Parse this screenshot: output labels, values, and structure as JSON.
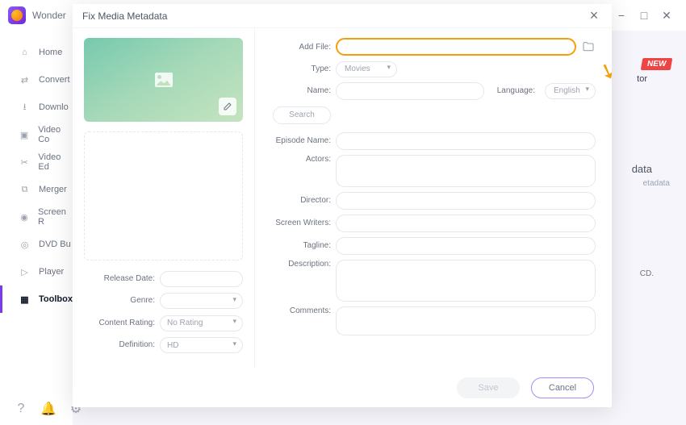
{
  "app": {
    "name": "Wonder"
  },
  "window": {
    "min": "−",
    "max": "□",
    "close": "✕"
  },
  "sidebar": {
    "items": [
      {
        "label": "Home"
      },
      {
        "label": "Convert"
      },
      {
        "label": "Downlo"
      },
      {
        "label": "Video Co"
      },
      {
        "label": "Video Ed"
      },
      {
        "label": "Merger"
      },
      {
        "label": "Screen R"
      },
      {
        "label": "DVD Bu"
      },
      {
        "label": "Player"
      },
      {
        "label": "Toolbox"
      }
    ]
  },
  "bg": {
    "badge": "NEW",
    "hint1": "tor",
    "heading": "data",
    "sub": "etadata",
    "cd": "CD."
  },
  "modal": {
    "title": "Fix Media Metadata",
    "addfile": {
      "label": "Add File:"
    },
    "type": {
      "label": "Type:",
      "value": "Movies"
    },
    "name": {
      "label": "Name:"
    },
    "language": {
      "label": "Language:",
      "value": "English"
    },
    "search": "Search",
    "episode": {
      "label": "Episode Name:"
    },
    "actors": {
      "label": "Actors:"
    },
    "director": {
      "label": "Director:"
    },
    "writers": {
      "label": "Screen Writers:"
    },
    "tagline": {
      "label": "Tagline:"
    },
    "description": {
      "label": "Description:"
    },
    "comments": {
      "label": "Comments:"
    },
    "left": {
      "release": {
        "label": "Release Date:"
      },
      "genre": {
        "label": "Genre:"
      },
      "rating": {
        "label": "Content Rating:",
        "value": "No Rating"
      },
      "definition": {
        "label": "Definition:",
        "value": "HD"
      }
    },
    "footer": {
      "save": "Save",
      "cancel": "Cancel"
    }
  }
}
